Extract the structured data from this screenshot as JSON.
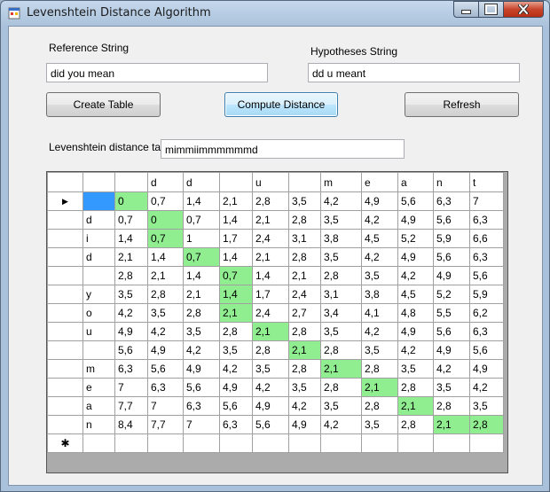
{
  "window": {
    "title": "Levenshtein Distance Algorithm"
  },
  "form": {
    "reference_label": "Reference String",
    "reference_value": "did you mean",
    "hypotheses_label": "Hypotheses String",
    "hypotheses_value": "dd u meant",
    "create_table_label": "Create Table",
    "compute_distance_label": "Compute Distance",
    "refresh_label": "Refresh",
    "distance_label": "Levenshtein distance ta",
    "distance_value": "mimmiimmmmmmd"
  },
  "grid": {
    "current_row_glyph": "▶",
    "new_row_glyph": "✱",
    "columns": [
      "",
      "",
      "d",
      "d",
      "",
      "u",
      "",
      "m",
      "e",
      "a",
      "n",
      "t"
    ],
    "rows": [
      {
        "label": "",
        "cells": [
          "",
          "0",
          "0,7",
          "1,4",
          "2,1",
          "2,8",
          "3,5",
          "4,2",
          "4,9",
          "5,6",
          "6,3",
          "7"
        ]
      },
      {
        "label": "d",
        "cells": [
          "d",
          "0,7",
          "0",
          "0,7",
          "1,4",
          "2,1",
          "2,8",
          "3,5",
          "4,2",
          "4,9",
          "5,6",
          "6,3"
        ]
      },
      {
        "label": "i",
        "cells": [
          "i",
          "1,4",
          "0,7",
          "1",
          "1,7",
          "2,4",
          "3,1",
          "3,8",
          "4,5",
          "5,2",
          "5,9",
          "6,6"
        ]
      },
      {
        "label": "d",
        "cells": [
          "d",
          "2,1",
          "1,4",
          "0,7",
          "1,4",
          "2,1",
          "2,8",
          "3,5",
          "4,2",
          "4,9",
          "5,6",
          "6,3"
        ]
      },
      {
        "label": "",
        "cells": [
          "",
          "2,8",
          "2,1",
          "1,4",
          "0,7",
          "1,4",
          "2,1",
          "2,8",
          "3,5",
          "4,2",
          "4,9",
          "5,6"
        ]
      },
      {
        "label": "y",
        "cells": [
          "y",
          "3,5",
          "2,8",
          "2,1",
          "1,4",
          "1,7",
          "2,4",
          "3,1",
          "3,8",
          "4,5",
          "5,2",
          "5,9"
        ]
      },
      {
        "label": "o",
        "cells": [
          "o",
          "4,2",
          "3,5",
          "2,8",
          "2,1",
          "2,4",
          "2,7",
          "3,4",
          "4,1",
          "4,8",
          "5,5",
          "6,2"
        ]
      },
      {
        "label": "u",
        "cells": [
          "u",
          "4,9",
          "4,2",
          "3,5",
          "2,8",
          "2,1",
          "2,8",
          "3,5",
          "4,2",
          "4,9",
          "5,6",
          "6,3"
        ]
      },
      {
        "label": "",
        "cells": [
          "",
          "5,6",
          "4,9",
          "4,2",
          "3,5",
          "2,8",
          "2,1",
          "2,8",
          "3,5",
          "4,2",
          "4,9",
          "5,6"
        ]
      },
      {
        "label": "m",
        "cells": [
          "m",
          "6,3",
          "5,6",
          "4,9",
          "4,2",
          "3,5",
          "2,8",
          "2,1",
          "2,8",
          "3,5",
          "4,2",
          "4,9"
        ]
      },
      {
        "label": "e",
        "cells": [
          "e",
          "7",
          "6,3",
          "5,6",
          "4,9",
          "4,2",
          "3,5",
          "2,8",
          "2,1",
          "2,8",
          "3,5",
          "4,2"
        ]
      },
      {
        "label": "a",
        "cells": [
          "a",
          "7,7",
          "7",
          "6,3",
          "5,6",
          "4,9",
          "4,2",
          "3,5",
          "2,8",
          "2,1",
          "2,8",
          "3,5"
        ]
      },
      {
        "label": "n",
        "cells": [
          "n",
          "8,4",
          "7,7",
          "7",
          "6,3",
          "5,6",
          "4,9",
          "4,2",
          "3,5",
          "2,8",
          "2,1",
          "2,8"
        ]
      }
    ],
    "highlight_path": [
      [
        0,
        1
      ],
      [
        1,
        2
      ],
      [
        2,
        2
      ],
      [
        3,
        3
      ],
      [
        4,
        4
      ],
      [
        5,
        4
      ],
      [
        6,
        4
      ],
      [
        7,
        5
      ],
      [
        8,
        6
      ],
      [
        9,
        7
      ],
      [
        10,
        8
      ],
      [
        11,
        9
      ],
      [
        12,
        10
      ],
      [
        12,
        11
      ]
    ],
    "highlight_color": "#90ee90",
    "selected_cell_color": "#3399ff"
  }
}
